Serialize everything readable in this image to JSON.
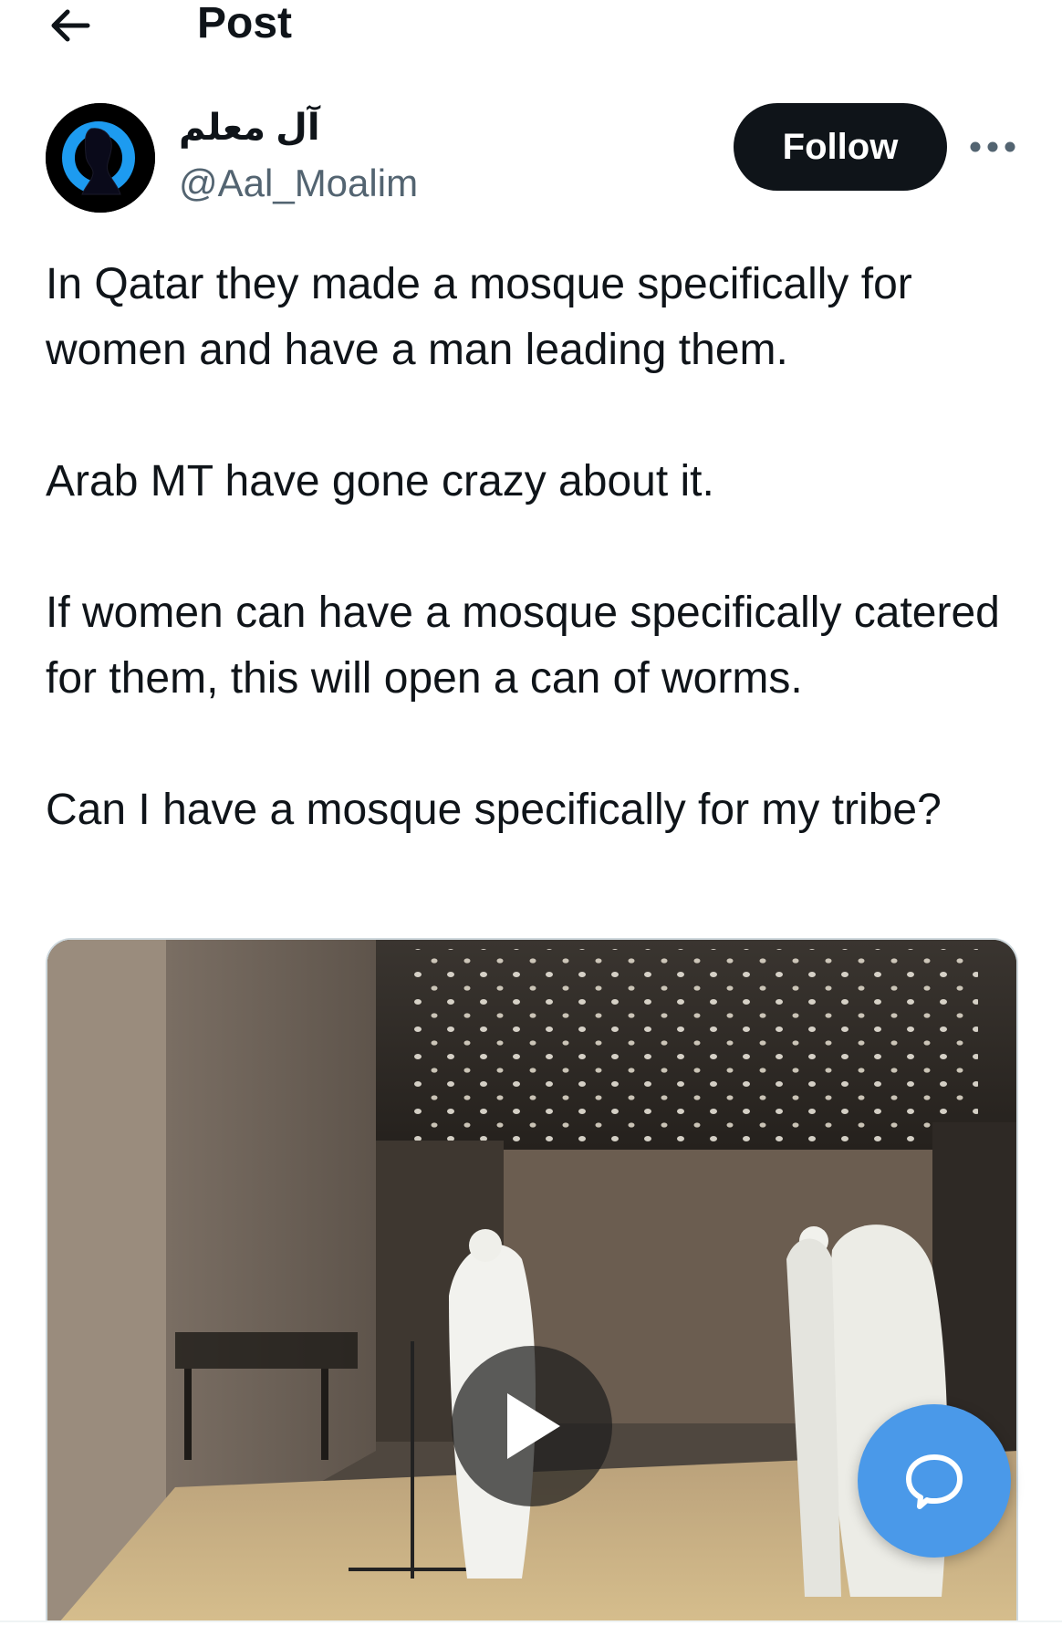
{
  "header": {
    "title": "Post",
    "back_icon": "arrow-left-icon"
  },
  "author": {
    "display_name": "آل معلم",
    "handle": "@Aal_Moalim",
    "avatar_icon": "avatar-silhouette-icon",
    "avatar_colors": {
      "background": "#000000",
      "ring": "#1d9bf0",
      "figure": "#0a0a1a"
    }
  },
  "actions": {
    "follow_label": "Follow",
    "more_icon": "more-horizontal-icon"
  },
  "post": {
    "paragraphs": [
      "In Qatar they made a mosque specifically for women and have a man leading them.",
      "Arab MT have gone crazy about it.",
      "If women can have a mosque specifically catered for them, this will open a can of worms.",
      "Can I have a mosque specifically for my tribe?"
    ]
  },
  "media": {
    "type": "video",
    "play_icon": "play-icon"
  },
  "floating": {
    "chat_icon": "chat-bubble-icon",
    "chat_color": "#4a99e9"
  },
  "colors": {
    "text": "#0f1419",
    "secondary": "#536471",
    "follow_bg": "#0f1419"
  }
}
